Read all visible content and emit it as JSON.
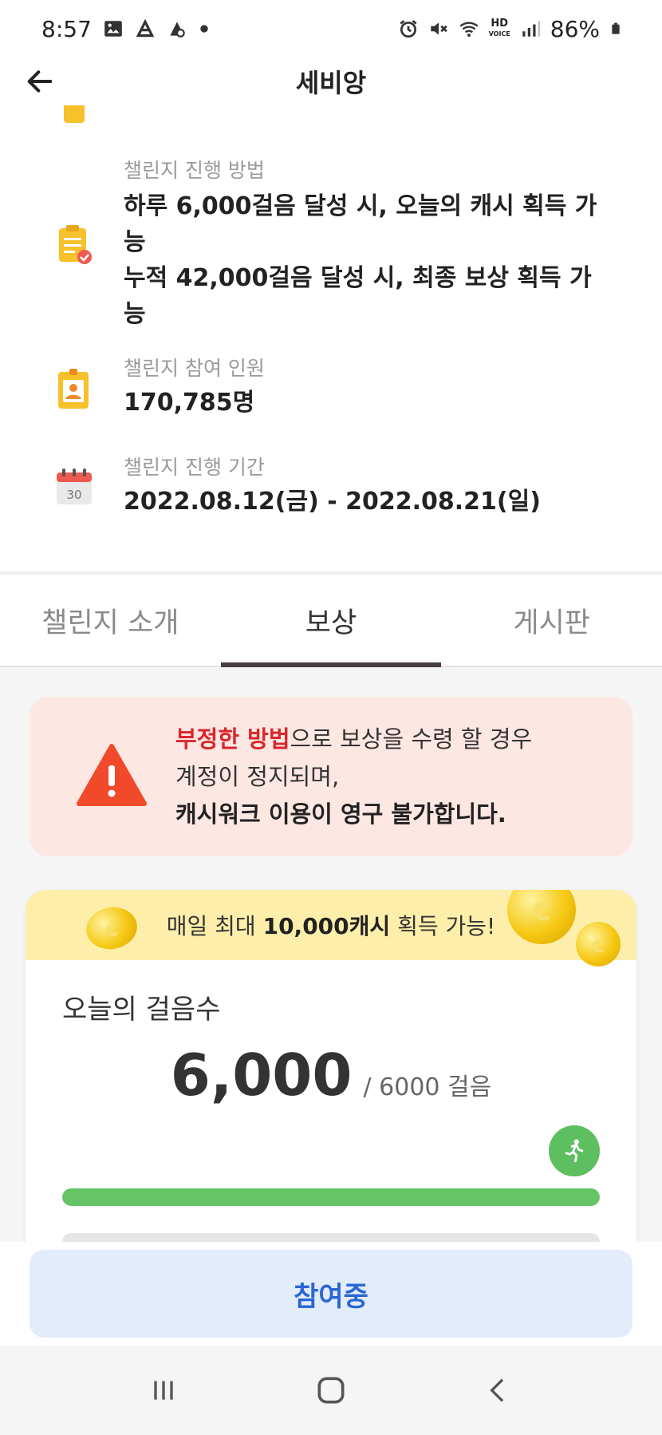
{
  "status_bar": {
    "time": "8:57",
    "battery_percent": "86%",
    "icons": [
      "gallery-icon",
      "app-notification-icon",
      "app-notification-icon",
      "dot-icon",
      "alarm-icon",
      "mute-icon",
      "wifi-icon",
      "hd-voice-icon",
      "signal-icon",
      "battery-icon"
    ],
    "hd_label_top": "HD",
    "hd_label_bottom": "VOICE"
  },
  "header": {
    "title": "세비앙",
    "back_icon": "arrow-left-icon"
  },
  "challenge_info": {
    "method": {
      "label": "챌린지 진행 방법",
      "line1": "하루 6,000걸음 달성 시, 오늘의 캐시 획득 가능",
      "line2": "누적 42,000걸음 달성 시, 최종 보상 획득 가능",
      "icon": "clipboard-check-icon"
    },
    "participants": {
      "label": "챌린지 참여 인원",
      "value": "170,785명",
      "icon": "id-badge-icon"
    },
    "period": {
      "label": "챌린지 진행 기간",
      "value": "2022.08.12(금) - 2022.08.21(일)",
      "icon": "calendar-icon",
      "icon_day": "30"
    }
  },
  "tabs": [
    {
      "label": "챌린지 소개",
      "active": false
    },
    {
      "label": "보상",
      "active": true
    },
    {
      "label": "게시판",
      "active": false
    }
  ],
  "warning": {
    "red_text": "부정한 방법",
    "line1_rest": "으로 보상을 수령 할 경우",
    "line2": "계정이 정지되며,",
    "line3": "캐시워크 이용이 영구 불가합니다.",
    "icon": "warning-triangle-icon"
  },
  "steps_card": {
    "banner_prefix": "매일 최대 ",
    "banner_bold": "10,000캐시",
    "banner_suffix": " 획득 가능!",
    "title": "오늘의 걸음수",
    "steps": "6,000",
    "goal": "/ 6000 걸음",
    "progress": 1.0,
    "runner_icon": "running-person-icon",
    "coin_icon": "coin-icon"
  },
  "join_button": {
    "label": "참여중"
  },
  "nav_bar": {
    "icons": [
      "recent-apps-icon",
      "home-icon",
      "back-chevron-icon"
    ]
  },
  "colors": {
    "accent_red": "#d9262c",
    "progress_green": "#64c466",
    "join_blue": "#2a66d4",
    "banner_yellow": "#fdeeaa",
    "warning_bg": "#fde7e2"
  }
}
